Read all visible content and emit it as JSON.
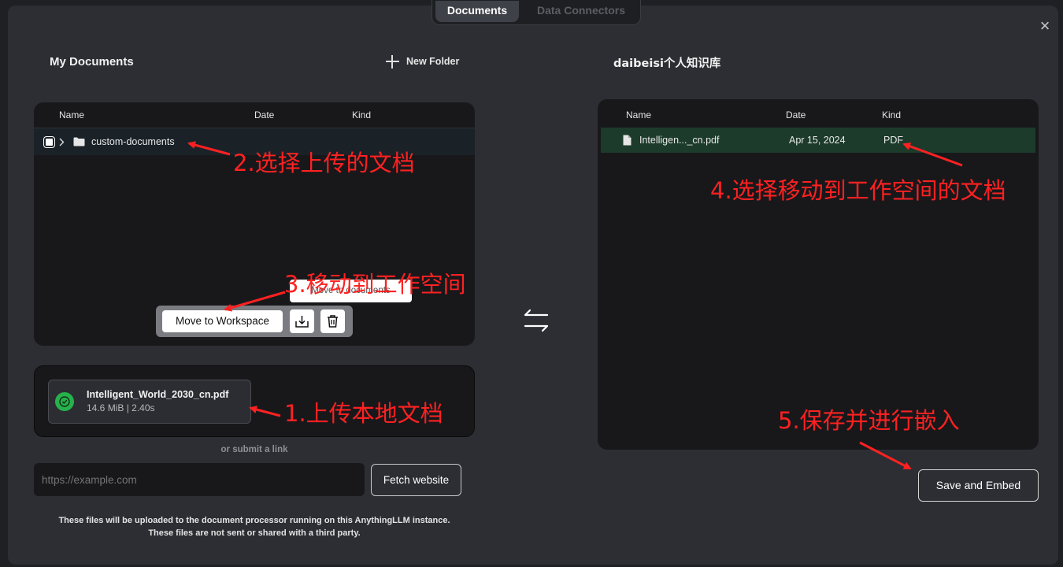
{
  "tabs": [
    {
      "label": "Documents",
      "active": true
    },
    {
      "label": "Data Connectors",
      "active": false
    }
  ],
  "left": {
    "title": "My Documents",
    "new_folder_label": "New Folder",
    "columns": [
      "Name",
      "Date",
      "Kind"
    ],
    "folder": {
      "name": "custom-documents"
    },
    "tooltip_text": "Move to documents",
    "move_button_label": "Move to Workspace"
  },
  "upload": {
    "file_name": "Intelligent_World_2030_cn.pdf",
    "file_meta": "14.6 MiB | 2.40s",
    "or_submit": "or submit a link",
    "url_placeholder": "https://example.com",
    "fetch_label": "Fetch website",
    "footnote_line1": "These files will be uploaded to the document processor running on this AnythingLLM instance.",
    "footnote_line2": "These files are not sent or shared with a third party."
  },
  "right": {
    "title": "daibeisi个人知识库",
    "columns": [
      "Name",
      "Date",
      "Kind"
    ],
    "row": {
      "name": "Intelligen..._cn.pdf",
      "date": "Apr 15, 2024",
      "kind": "PDF"
    },
    "save_label": "Save and Embed"
  },
  "annotations": {
    "a1": "1.上传本地文档",
    "a2": "2.选择上传的文档",
    "a3": "3.移动到工作空间",
    "a4": "4.选择移动到工作空间的文档",
    "a5": "5.保存并进行嵌入"
  },
  "colors": {
    "accent_annotation": "#ff2121",
    "success_icon": "#27b14b",
    "selected_row": "#1c3b2b"
  },
  "icons": [
    "plus-icon",
    "chevron-right-icon",
    "folder-icon",
    "check-circle-icon",
    "swap-arrows-icon",
    "file-icon",
    "move-down-icon",
    "trash-icon",
    "close-icon"
  ]
}
